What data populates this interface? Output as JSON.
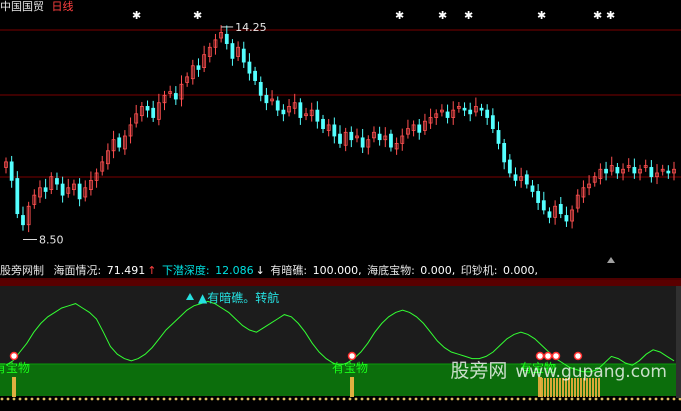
{
  "header": {
    "stock_name": "中国国贸",
    "period": "日线"
  },
  "price_panel": {
    "high_label": "14.25",
    "low_label": "8.50",
    "high_price": 14.25,
    "low_price": 8.5,
    "star_marks_count": 8
  },
  "indicator": {
    "title": "股旁网制",
    "items": [
      {
        "label": "海面情况:",
        "value": "71.491",
        "arrow": "↑"
      },
      {
        "label": "下潜深度:",
        "value": "12.086",
        "arrow": "↓"
      },
      {
        "label": "有暗礁:",
        "value": "100.000,",
        "arrow": ""
      },
      {
        "label": "海底宝物:",
        "value": "0.000,",
        "arrow": ""
      },
      {
        "label": "印钞机:",
        "value": "0.000,",
        "arrow": ""
      }
    ],
    "signal_text": "有暗礁。转航",
    "treasure_label": "有宝物"
  },
  "watermark": {
    "cn": "股旁网",
    "url": "www.gupang.com"
  },
  "chart_data": [
    {
      "type": "candlestick",
      "title": "",
      "ylim": [
        8.0,
        14.6
      ],
      "annotations": [
        "14.25",
        "8.50"
      ],
      "closes": [
        10.6,
        10.1,
        9.2,
        8.9,
        9.4,
        9.7,
        9.9,
        9.8,
        10.2,
        10.0,
        9.7,
        9.9,
        10.0,
        9.6,
        9.9,
        10.1,
        10.3,
        10.6,
        10.9,
        11.2,
        11.0,
        11.3,
        11.6,
        11.9,
        12.1,
        12.0,
        11.8,
        12.2,
        12.4,
        12.5,
        12.3,
        12.7,
        12.9,
        13.2,
        13.1,
        13.5,
        13.7,
        13.9,
        14.1,
        13.8,
        13.4,
        13.7,
        13.3,
        13.0,
        12.8,
        12.4,
        12.2,
        12.3,
        12.0,
        11.9,
        12.1,
        12.2,
        11.8,
        11.9,
        12.0,
        11.7,
        11.5,
        11.6,
        11.3,
        11.1,
        11.4,
        11.2,
        11.3,
        11.0,
        11.2,
        11.4,
        11.2,
        11.3,
        11.0,
        11.1,
        11.3,
        11.5,
        11.6,
        11.4,
        11.7,
        11.8,
        11.9,
        12.0,
        11.8,
        12.0,
        12.1,
        12.0,
        11.9,
        12.1,
        12.0,
        11.8,
        11.5,
        11.1,
        10.6,
        10.3,
        10.1,
        10.2,
        10.0,
        9.8,
        9.5,
        9.3,
        9.1,
        9.4,
        9.2,
        9.0,
        9.3,
        9.7,
        9.9,
        10.0,
        10.2,
        10.4,
        10.3,
        10.5,
        10.3,
        10.4,
        10.5,
        10.3,
        10.4,
        10.5,
        10.2,
        10.3,
        10.4,
        10.3,
        10.4
      ]
    },
    {
      "type": "line",
      "name": "海面情况",
      "ylim": [
        0,
        100
      ],
      "values": [
        28,
        32,
        40,
        48,
        58,
        66,
        72,
        76,
        80,
        82,
        84,
        80,
        76,
        70,
        58,
        45,
        38,
        34,
        32,
        34,
        38,
        44,
        52,
        60,
        66,
        72,
        78,
        82,
        84,
        86,
        84,
        80,
        76,
        70,
        64,
        60,
        58,
        62,
        66,
        70,
        74,
        72,
        66,
        58,
        48,
        40,
        34,
        30,
        28,
        30,
        34,
        40,
        48,
        58,
        66,
        72,
        76,
        78,
        76,
        72,
        66,
        58,
        50,
        44,
        40,
        38,
        36,
        34,
        34,
        36,
        40,
        46,
        52,
        56,
        58,
        56,
        52,
        46,
        40,
        34,
        30,
        26,
        24,
        22,
        22,
        24,
        30,
        36,
        34,
        30,
        28,
        32,
        38,
        42,
        40,
        36,
        32
      ]
    }
  ]
}
